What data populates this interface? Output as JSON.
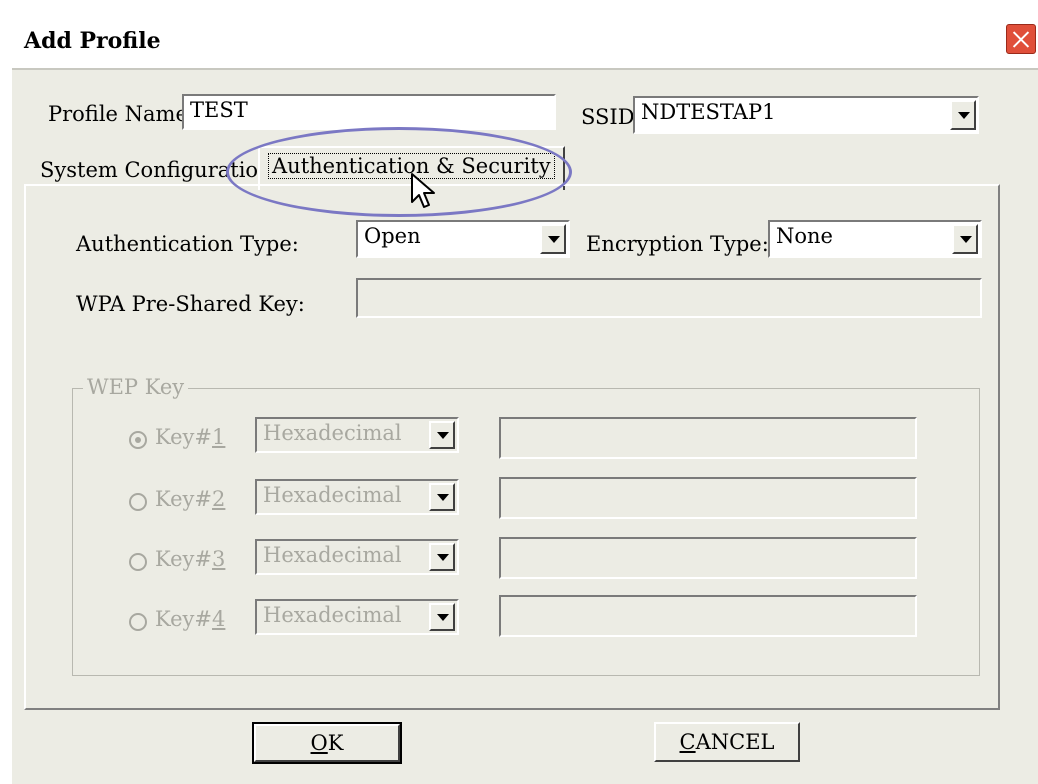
{
  "window": {
    "title": "Add Profile"
  },
  "profile": {
    "name_label": "Profile Name",
    "name_value": "TEST",
    "ssid_label": "SSID",
    "ssid_value": "NDTESTAP1"
  },
  "tabs": [
    {
      "label": "System Configuration",
      "active": false
    },
    {
      "label": "Authentication & Security",
      "active": true
    }
  ],
  "auth": {
    "auth_type_label": "Authentication Type:",
    "auth_type_value": "Open",
    "enc_type_label": "Encryption Type:",
    "enc_type_value": "None",
    "psk_label": "WPA Pre-Shared Key:",
    "psk_value": ""
  },
  "wep": {
    "legend": "WEP Key",
    "keys": [
      {
        "label_prefix": "Key#",
        "label_num": "1",
        "format": "Hexadecimal",
        "value": "",
        "selected": true
      },
      {
        "label_prefix": "Key#",
        "label_num": "2",
        "format": "Hexadecimal",
        "value": "",
        "selected": false
      },
      {
        "label_prefix": "Key#",
        "label_num": "3",
        "format": "Hexadecimal",
        "value": "",
        "selected": false
      },
      {
        "label_prefix": "Key#",
        "label_num": "4",
        "format": "Hexadecimal",
        "value": "",
        "selected": false
      }
    ]
  },
  "buttons": {
    "ok_mnemonic": "O",
    "ok_rest": "K",
    "cancel_mnemonic": "C",
    "cancel_rest": "ANCEL"
  },
  "colors": {
    "highlight_ellipse": "#7b78c4",
    "close_button": "#e04f3a",
    "dialog_bg": "#ecece4"
  }
}
